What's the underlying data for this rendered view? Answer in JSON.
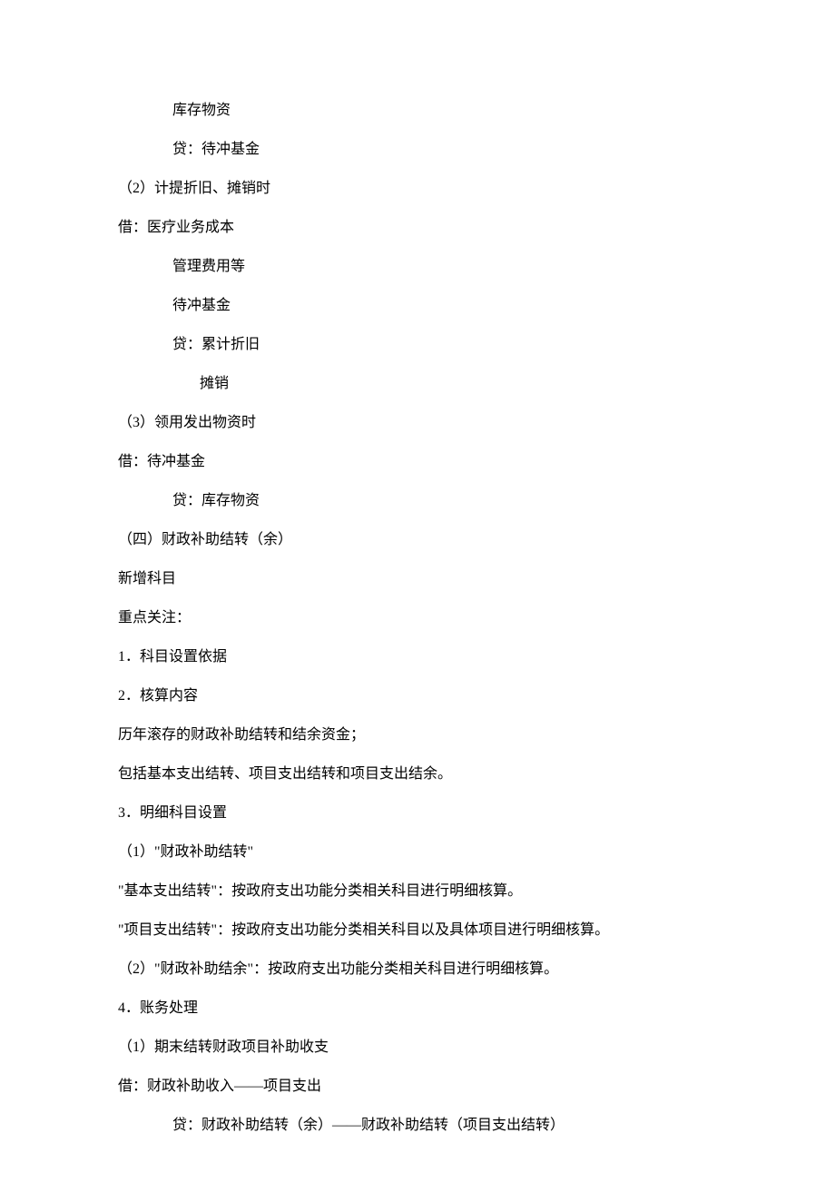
{
  "lines": [
    {
      "text": "库存物资",
      "indent": 1
    },
    {
      "text": "贷：待冲基金",
      "indent": 1
    },
    {
      "text": "（2）计提折旧、摊销时",
      "indent": 0
    },
    {
      "text": "借：医疗业务成本",
      "indent": 0
    },
    {
      "text": "管理费用等",
      "indent": 1
    },
    {
      "text": "待冲基金",
      "indent": 1
    },
    {
      "text": "贷：累计折旧",
      "indent": 1
    },
    {
      "text": "摊销",
      "indent": 2
    },
    {
      "text": "（3）领用发出物资时",
      "indent": 0
    },
    {
      "text": "借：待冲基金",
      "indent": 0
    },
    {
      "text": "贷：库存物资",
      "indent": 1
    },
    {
      "text": "（四）财政补助结转（余）",
      "indent": 0
    },
    {
      "text": "新增科目",
      "indent": 0
    },
    {
      "text": "重点关注：",
      "indent": 0
    },
    {
      "text": "1．科目设置依据",
      "indent": 0
    },
    {
      "text": "2．核算内容",
      "indent": 0
    },
    {
      "text": "历年滚存的财政补助结转和结余资金；",
      "indent": 0
    },
    {
      "text": "包括基本支出结转、项目支出结转和项目支出结余。",
      "indent": 0
    },
    {
      "text": "3．明细科目设置",
      "indent": 0
    },
    {
      "text": "（1）\"财政补助结转\"",
      "indent": 0
    },
    {
      "text": "\"基本支出结转\"：按政府支出功能分类相关科目进行明细核算。",
      "indent": 0
    },
    {
      "text": "\"项目支出结转\"：按政府支出功能分类相关科目以及具体项目进行明细核算。",
      "indent": 0
    },
    {
      "text": "（2）\"财政补助结余\"：按政府支出功能分类相关科目进行明细核算。",
      "indent": 0
    },
    {
      "text": "4．账务处理",
      "indent": 0
    },
    {
      "text": "（1）期末结转财政项目补助收支",
      "indent": 0
    },
    {
      "text": "借：财政补助收入——项目支出",
      "indent": 0
    },
    {
      "text": "贷：财政补助结转（余）——财政补助结转（项目支出结转）",
      "indent": 1
    }
  ]
}
